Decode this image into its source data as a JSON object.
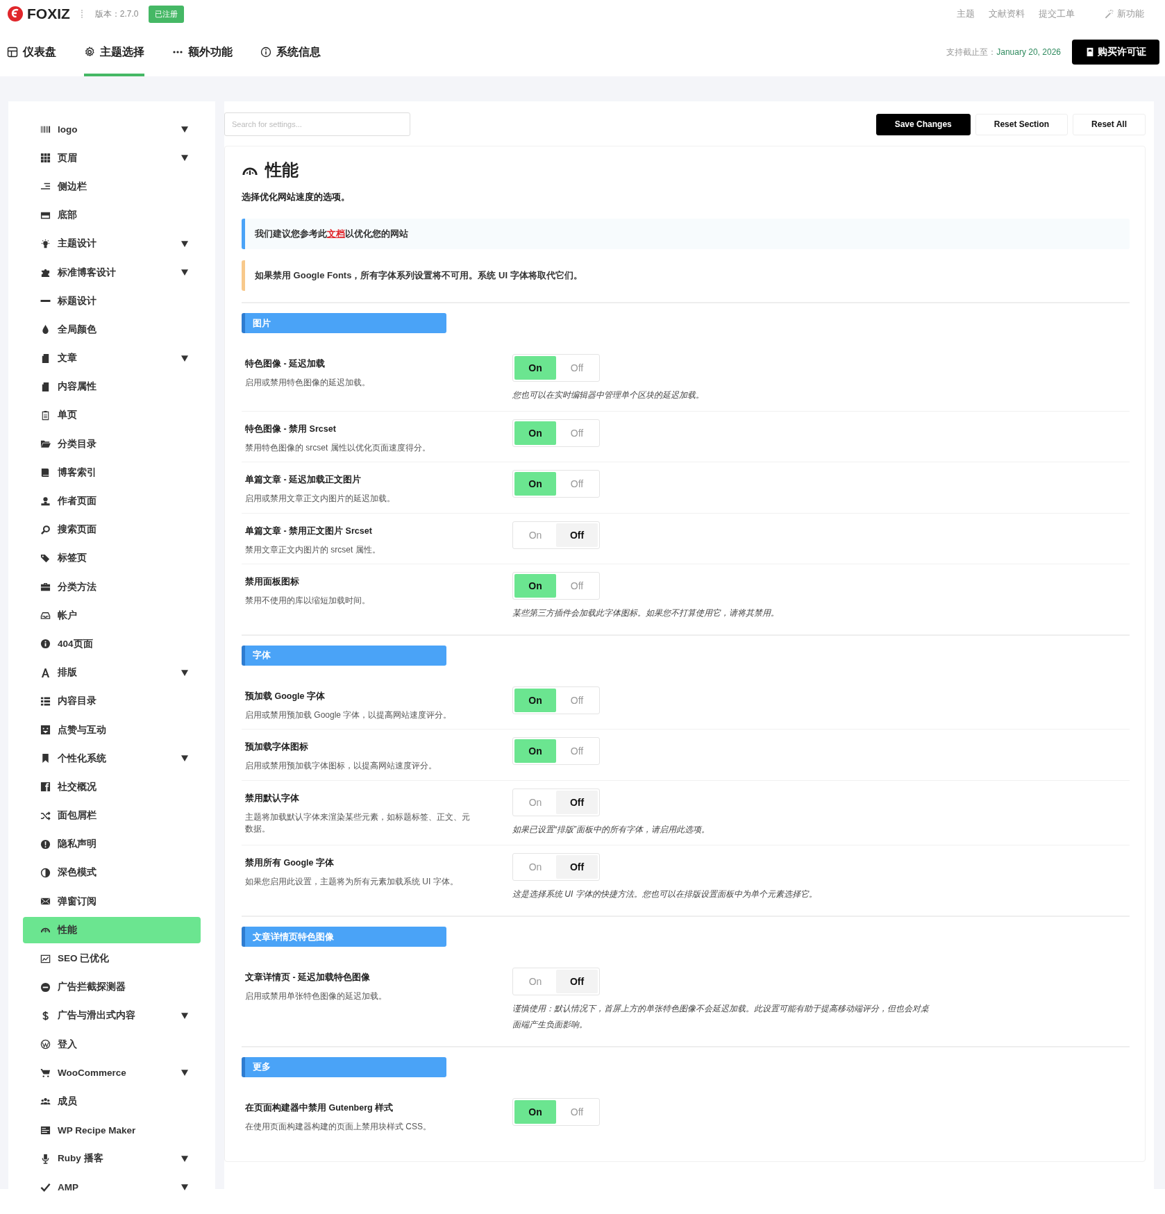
{
  "header": {
    "logo": "FOXIZ",
    "version": "版本：2.7.0",
    "badge": "已注册",
    "links": [
      "主题",
      "文献资料",
      "提交工单"
    ],
    "new_feature": "新功能"
  },
  "nav": {
    "tabs": [
      {
        "label": "仪表盘",
        "selected": false
      },
      {
        "label": "主题选择",
        "selected": true
      },
      {
        "label": "额外功能",
        "selected": false
      },
      {
        "label": "系统信息",
        "selected": false
      }
    ],
    "support_label": "支持截止至：",
    "support_date": "January 20, 2026",
    "buy_button": "购买许可证"
  },
  "sidebar": {
    "items": [
      {
        "label": "logo",
        "has_submenu": true,
        "selected": false
      },
      {
        "label": "页眉",
        "has_submenu": true,
        "selected": false
      },
      {
        "label": "侧边栏",
        "has_submenu": false,
        "selected": false
      },
      {
        "label": "底部",
        "has_submenu": false,
        "selected": false
      },
      {
        "label": "主题设计",
        "has_submenu": true,
        "selected": false
      },
      {
        "label": "标准博客设计",
        "has_submenu": true,
        "selected": false
      },
      {
        "label": "标题设计",
        "has_submenu": false,
        "selected": false
      },
      {
        "label": "全局颜色",
        "has_submenu": false,
        "selected": false
      },
      {
        "label": "文章",
        "has_submenu": true,
        "selected": false
      },
      {
        "label": "内容属性",
        "has_submenu": false,
        "selected": false
      },
      {
        "label": "单页",
        "has_submenu": false,
        "selected": false
      },
      {
        "label": "分类目录",
        "has_submenu": false,
        "selected": false
      },
      {
        "label": "博客索引",
        "has_submenu": false,
        "selected": false
      },
      {
        "label": "作者页面",
        "has_submenu": false,
        "selected": false
      },
      {
        "label": "搜索页面",
        "has_submenu": false,
        "selected": false
      },
      {
        "label": "标签页",
        "has_submenu": false,
        "selected": false
      },
      {
        "label": "分类方法",
        "has_submenu": false,
        "selected": false
      },
      {
        "label": "帐户",
        "has_submenu": false,
        "selected": false
      },
      {
        "label": "404页面",
        "has_submenu": false,
        "selected": false
      },
      {
        "label": "排版",
        "has_submenu": true,
        "selected": false
      },
      {
        "label": "内容目录",
        "has_submenu": false,
        "selected": false
      },
      {
        "label": "点赞与互动",
        "has_submenu": false,
        "selected": false
      },
      {
        "label": "个性化系统",
        "has_submenu": true,
        "selected": false
      },
      {
        "label": "社交概况",
        "has_submenu": false,
        "selected": false
      },
      {
        "label": "面包屑栏",
        "has_submenu": false,
        "selected": false
      },
      {
        "label": "隐私声明",
        "has_submenu": false,
        "selected": false
      },
      {
        "label": "深色模式",
        "has_submenu": false,
        "selected": false
      },
      {
        "label": "弹窗订阅",
        "has_submenu": false,
        "selected": false
      },
      {
        "label": "性能",
        "has_submenu": false,
        "selected": true
      },
      {
        "label": "SEO 已优化",
        "has_submenu": false,
        "selected": false
      },
      {
        "label": "广告拦截探测器",
        "has_submenu": false,
        "selected": false
      },
      {
        "label": "广告与滑出式内容",
        "has_submenu": true,
        "selected": false
      },
      {
        "label": "登入",
        "has_submenu": false,
        "selected": false
      },
      {
        "label": "WooCommerce",
        "has_submenu": true,
        "selected": false
      },
      {
        "label": "成员",
        "has_submenu": false,
        "selected": false
      },
      {
        "label": "WP Recipe Maker",
        "has_submenu": false,
        "selected": false
      },
      {
        "label": "Ruby 播客",
        "has_submenu": true,
        "selected": false
      },
      {
        "label": "AMP",
        "has_submenu": true,
        "selected": false
      }
    ]
  },
  "toolbar": {
    "search": {
      "placeholder": "Search for settings..."
    },
    "buttons": [
      {
        "label": "Save Changes",
        "kind": "primary"
      },
      {
        "label": "Reset Section",
        "kind": "secondary"
      },
      {
        "label": "Reset All",
        "kind": "secondary"
      }
    ]
  },
  "panel": {
    "title": "性能",
    "subtitle": "选择优化网站速度的选项。",
    "notices": [
      {
        "kind": "info",
        "text_before": "我们建议您参考此",
        "link": "文档",
        "text_after": "以优化您的网站"
      },
      {
        "kind": "warning",
        "text_before": "如果禁用 Google Fonts，所有字体系列设置将不可用。系统 UI 字体将取代它们。"
      }
    ],
    "sections": [
      {
        "title": "图片",
        "settings": [
          {
            "title": "特色图像 - 延迟加载",
            "description": "启用或禁用特色图像的延迟加载。",
            "options": [
              {
                "label": "On",
                "selected": true
              },
              {
                "label": "Off",
                "selected": false
              }
            ],
            "note": "您也可以在实时编辑器中管理单个区块的延迟加载。"
          },
          {
            "title": "特色图像 - 禁用 Srcset",
            "description": "禁用特色图像的 srcset 属性以优化页面速度得分。",
            "options": [
              {
                "label": "On",
                "selected": true
              },
              {
                "label": "Off",
                "selected": false
              }
            ]
          },
          {
            "title": "单篇文章 - 延迟加载正文图片",
            "description": "启用或禁用文章正文内图片的延迟加载。",
            "options": [
              {
                "label": "On",
                "selected": true
              },
              {
                "label": "Off",
                "selected": false
              }
            ]
          },
          {
            "title": "单篇文章 - 禁用正文图片 Srcset",
            "description": "禁用文章正文内图片的 srcset 属性。",
            "options": [
              {
                "label": "On",
                "selected": false
              },
              {
                "label": "Off",
                "selected": true
              }
            ]
          },
          {
            "title": "禁用面板图标",
            "description": "禁用不使用的库以缩短加载时间。",
            "options": [
              {
                "label": "On",
                "selected": true
              },
              {
                "label": "Off",
                "selected": false
              }
            ],
            "note": "某些第三方插件会加载此字体图标。如果您不打算使用它，请将其禁用。"
          }
        ]
      },
      {
        "title": "字体",
        "settings": [
          {
            "title": "预加载 Google 字体",
            "description": "启用或禁用预加载 Google 字体，以提高网站速度评分。",
            "options": [
              {
                "label": "On",
                "selected": true
              },
              {
                "label": "Off",
                "selected": false
              }
            ]
          },
          {
            "title": "预加载字体图标",
            "description": "启用或禁用预加载字体图标，以提高网站速度评分。",
            "options": [
              {
                "label": "On",
                "selected": true
              },
              {
                "label": "Off",
                "selected": false
              }
            ]
          },
          {
            "title": "禁用默认字体",
            "description": "主题将加载默认字体来渲染某些元素，如标题标签、正文、元数据。",
            "options": [
              {
                "label": "On",
                "selected": false
              },
              {
                "label": "Off",
                "selected": true
              }
            ],
            "note": "如果已设置“排版”面板中的所有字体，请启用此选项。"
          },
          {
            "title": "禁用所有 Google 字体",
            "description": "如果您启用此设置，主题将为所有元素加载系统 UI 字体。",
            "options": [
              {
                "label": "On",
                "selected": false
              },
              {
                "label": "Off",
                "selected": true
              }
            ],
            "note": "这是选择系统 UI 字体的快捷方法。您也可以在排版设置面板中为单个元素选择它。"
          }
        ]
      },
      {
        "title": "文章详情页特色图像",
        "settings": [
          {
            "title": "文章详情页 - 延迟加载特色图像",
            "description": "启用或禁用单张特色图像的延迟加载。",
            "options": [
              {
                "label": "On",
                "selected": false
              },
              {
                "label": "Off",
                "selected": true
              }
            ],
            "note": "谨慎使用：默认情况下，首屏上方的单张特色图像不会延迟加载。此设置可能有助于提高移动端评分，但也会对桌面端产生负面影响。"
          }
        ]
      },
      {
        "title": "更多",
        "settings": [
          {
            "title": "在页面构建器中禁用 Gutenberg 样式",
            "description": "在使用页面构建器构建的页面上禁用块样式 CSS。",
            "options": [
              {
                "label": "On",
                "selected": true
              },
              {
                "label": "Off",
                "selected": false
              }
            ]
          }
        ]
      }
    ]
  }
}
